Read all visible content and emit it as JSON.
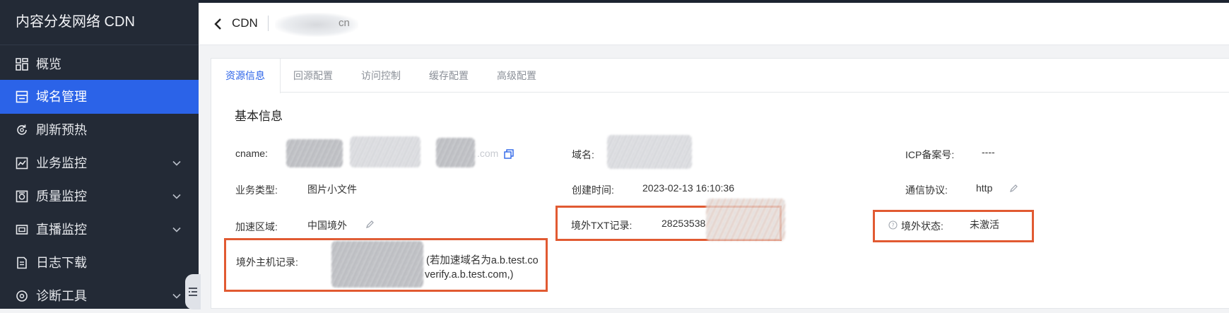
{
  "sidebar": {
    "title": "内容分发网络 CDN",
    "items": [
      {
        "label": "概览",
        "icon": "overview-icon",
        "active": false,
        "expandable": false
      },
      {
        "label": "域名管理",
        "icon": "domain-icon",
        "active": true,
        "expandable": false
      },
      {
        "label": "刷新预热",
        "icon": "refresh-icon",
        "active": false,
        "expandable": false
      },
      {
        "label": "业务监控",
        "icon": "business-monitor-icon",
        "active": false,
        "expandable": true
      },
      {
        "label": "质量监控",
        "icon": "quality-monitor-icon",
        "active": false,
        "expandable": true
      },
      {
        "label": "直播监控",
        "icon": "live-monitor-icon",
        "active": false,
        "expandable": true
      },
      {
        "label": "日志下载",
        "icon": "log-download-icon",
        "active": false,
        "expandable": false
      },
      {
        "label": "诊断工具",
        "icon": "diagnose-icon",
        "active": false,
        "expandable": true
      }
    ]
  },
  "header": {
    "back_label": "CDN",
    "domain_suffix": "cn"
  },
  "tabs": [
    "资源信息",
    "回源配置",
    "访问控制",
    "缓存配置",
    "高级配置"
  ],
  "section_title": "基本信息",
  "fields": {
    "cname": {
      "label": "cname:",
      "value": ".com"
    },
    "domain": {
      "label": "域名:"
    },
    "icp": {
      "label": "ICP备案号:",
      "value": "----"
    },
    "biz_type": {
      "label": "业务类型:",
      "value": "图片小文件"
    },
    "created": {
      "label": "创建时间:",
      "value": "2023-02-13 16:10:36"
    },
    "protocol": {
      "label": "通信协议:",
      "value": "http"
    },
    "region": {
      "label": "加速区域:",
      "value": "中国境外"
    },
    "txt": {
      "label": "境外TXT记录:",
      "value": "28253538"
    },
    "status": {
      "label": "境外状态:",
      "value": "未激活"
    },
    "host": {
      "label": "境外主机记录:",
      "line1": "(若加速域名为a.b.test.co",
      "line2": "verify.a.b.test.com,)"
    }
  },
  "colors": {
    "sidebar_bg": "#232a36",
    "active": "#2b63e8",
    "highlight": "#e15a32"
  }
}
